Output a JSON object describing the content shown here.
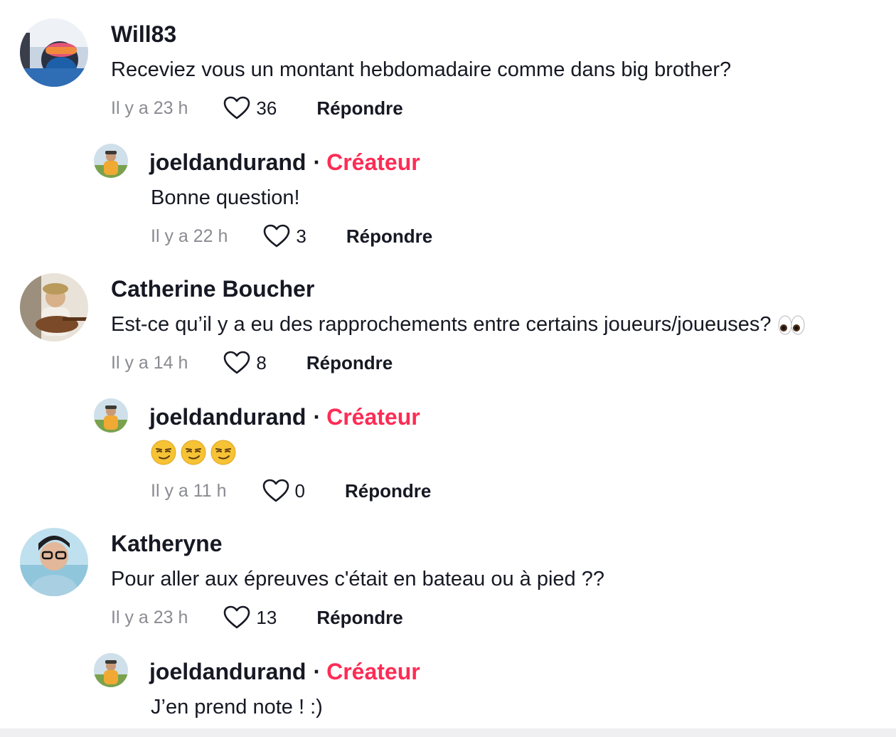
{
  "colors": {
    "creator_accent": "#fe2c55",
    "text_primary": "#161823",
    "text_secondary": "#8a8b91"
  },
  "comments": [
    {
      "username": "Will83",
      "text": "Receviez vous un montant hebdomadaire comme dans big brother?",
      "time": "Il y a 23 h",
      "likes": "36",
      "reply_label": "Répondre",
      "replies": [
        {
          "username": "joeldandurand",
          "badge": "Créateur",
          "text": "Bonne question!",
          "time": "Il y a 22 h",
          "likes": "3",
          "reply_label": "Répondre"
        }
      ]
    },
    {
      "username": "Catherine Boucher",
      "text": "Est-ce qu’il y a eu des rapprochements entre certains joueurs/joueuses?",
      "trailing_emoji": "eyes",
      "time": "Il y a 14 h",
      "likes": "8",
      "reply_label": "Répondre",
      "replies": [
        {
          "username": "joeldandurand",
          "badge": "Créateur",
          "text_emoji": [
            "smirking-face",
            "smirking-face",
            "smirking-face"
          ],
          "time": "Il y a 11 h",
          "likes": "0",
          "reply_label": "Répondre"
        }
      ]
    },
    {
      "username": "Katheryne",
      "text": "Pour aller aux épreuves c'était en bateau ou à pied ??",
      "time": "Il y a 23 h",
      "likes": "13",
      "reply_label": "Répondre",
      "replies": [
        {
          "username": "joeldandurand",
          "badge": "Créateur",
          "text": "J’en prend note ! :)"
        }
      ]
    }
  ],
  "icons": {
    "like": "heart-outline-icon"
  }
}
